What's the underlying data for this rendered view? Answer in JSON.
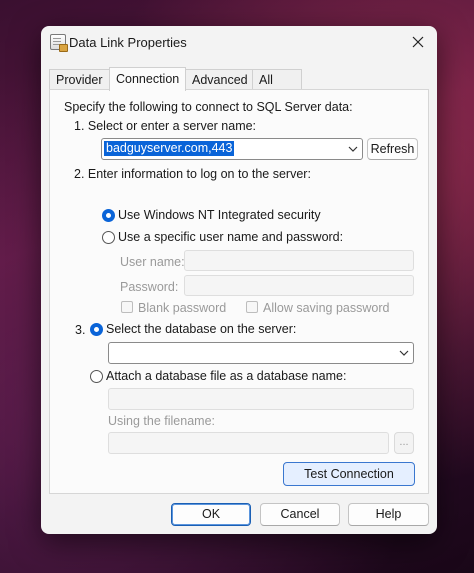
{
  "window": {
    "title": "Data Link Properties"
  },
  "tabs": [
    {
      "label": "Provider"
    },
    {
      "label": "Connection"
    },
    {
      "label": "Advanced"
    },
    {
      "label": "All"
    }
  ],
  "connection": {
    "intro": "Specify the following to connect to SQL Server data:",
    "step1_label": "1. Select or enter a server name:",
    "server_name_value": "badguyserver.com,443",
    "refresh_label": "Refresh",
    "step2_label": "2. Enter information to log on to the server:",
    "use_windows_nt_label": "Use Windows NT Integrated security",
    "use_specific_user_label": "Use a specific user name and password:",
    "user_name_label": "User name:",
    "password_label": "Password:",
    "blank_password_label": "Blank password",
    "allow_saving_password_label": "Allow saving password",
    "step3_number": "3.",
    "select_database_label": "Select the database on the server:",
    "database_value": "",
    "attach_database_label": "Attach a database file as a database name:",
    "using_filename_label": "Using the filename:",
    "browse_label": "...",
    "test_connection_label": "Test Connection",
    "logon_mode": "windows_nt",
    "database_mode": "select"
  },
  "footer": {
    "ok_label": "OK",
    "cancel_label": "Cancel",
    "help_label": "Help"
  }
}
